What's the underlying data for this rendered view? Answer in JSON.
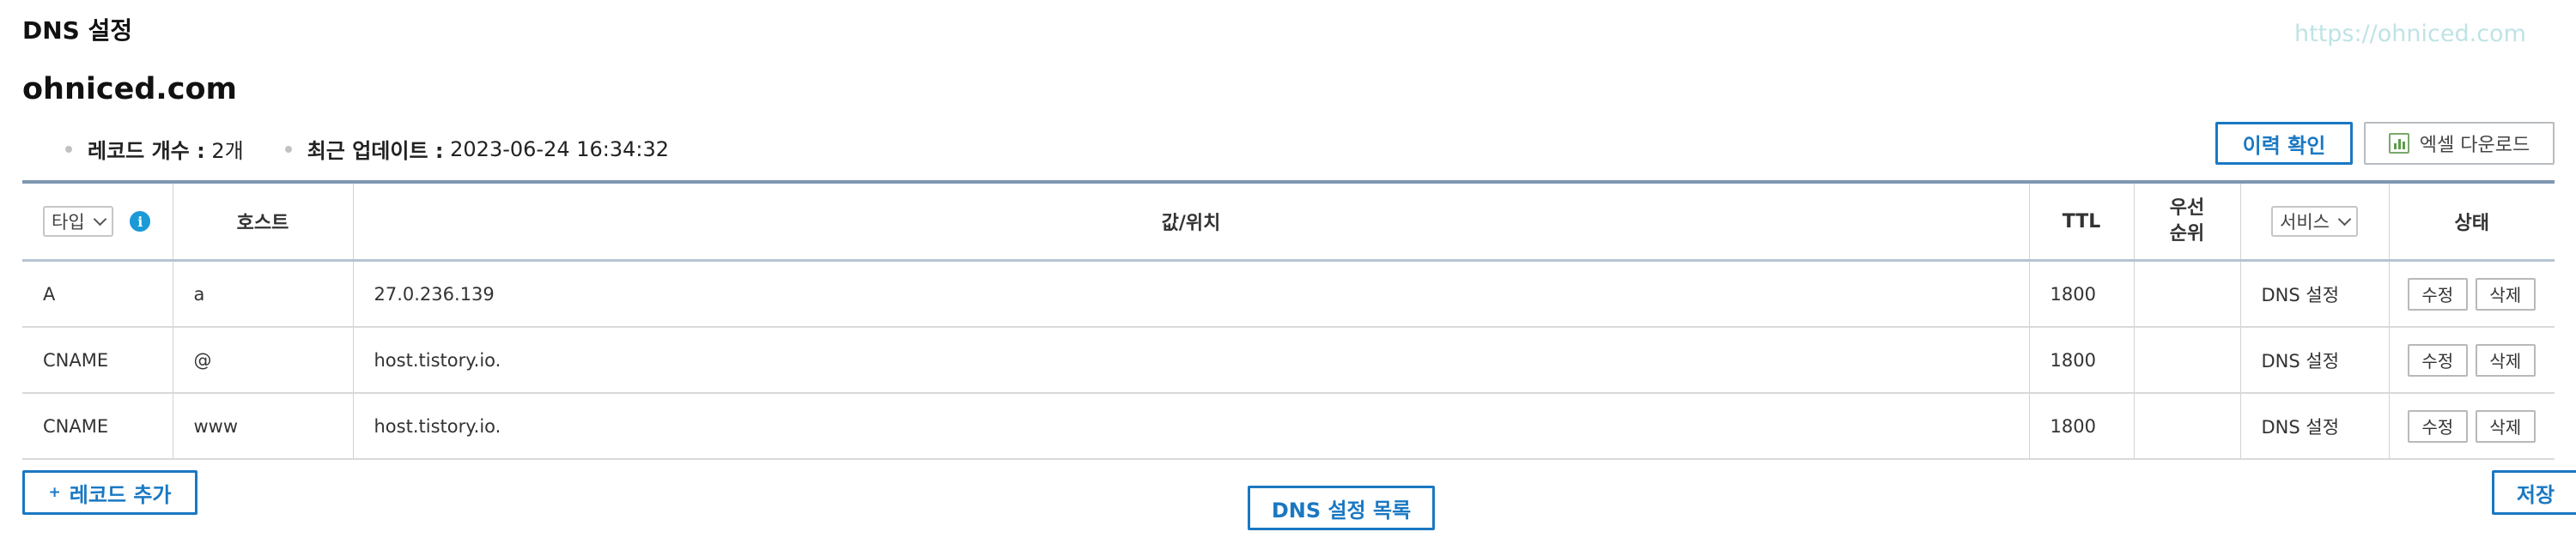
{
  "page": {
    "title": "DNS 설정",
    "watermark": "https://ohniced.com",
    "domain": "ohniced.com"
  },
  "meta": {
    "record_count_label": "레코드 개수 :",
    "record_count_value": " 2개",
    "last_update_label": "최근 업데이트 :",
    "last_update_value": " 2023-06-24 16:34:32"
  },
  "toolbar": {
    "history_label": "이력 확인",
    "excel_label": "엑셀 다운로드"
  },
  "table": {
    "type_filter": "타입",
    "headers": {
      "host": "호스트",
      "value": "값/위치",
      "ttl": "TTL",
      "priority": "우선\n순위",
      "status": "상태"
    },
    "service_filter": "서비스",
    "rows": [
      {
        "type": "A",
        "host": "a",
        "value": "27.0.236.139",
        "ttl": "1800",
        "priority": "",
        "service": "DNS 설정",
        "edit": "수정",
        "delete": "삭제"
      },
      {
        "type": "CNAME",
        "host": "@",
        "value": "host.tistory.io.",
        "ttl": "1800",
        "priority": "",
        "service": "DNS 설정",
        "edit": "수정",
        "delete": "삭제"
      },
      {
        "type": "CNAME",
        "host": "www",
        "value": "host.tistory.io.",
        "ttl": "1800",
        "priority": "",
        "service": "DNS 설정",
        "edit": "수정",
        "delete": "삭제"
      }
    ]
  },
  "footer": {
    "add_plus": "+",
    "add_record_label": "레코드 추가",
    "dns_list_label": "DNS 설정 목록",
    "save_label": "저장"
  },
  "colors": {
    "accent": "#1a78c2",
    "info": "#1a9ad6",
    "excel_icon": "#5e9c4a",
    "header_border": "#7e97b1"
  },
  "icons": {
    "info": "info-icon",
    "excel": "excel-chart-icon",
    "dropdown": "chevron-down-icon"
  }
}
